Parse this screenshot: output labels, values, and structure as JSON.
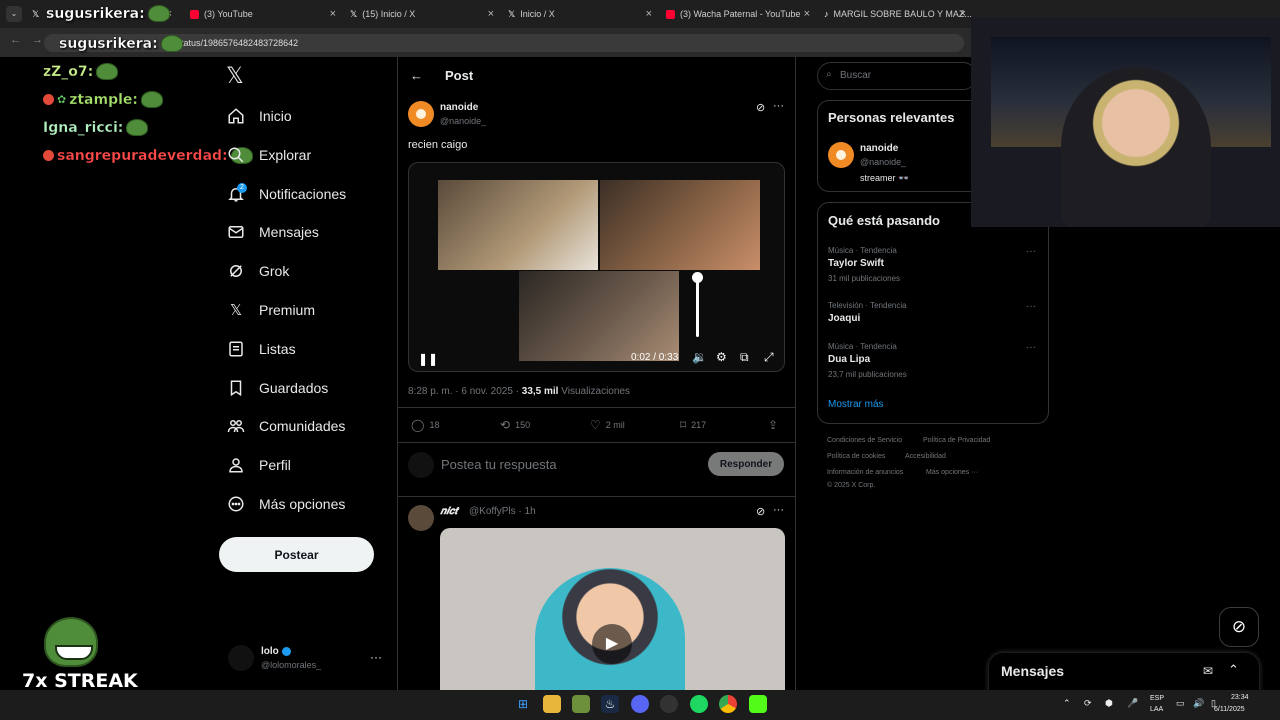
{
  "browser": {
    "tabs": [
      {
        "label": "",
        "icon": "x-icon",
        "color": "#ffffff"
      },
      {
        "label": "(3) YouTube",
        "icon": "youtube-icon",
        "color": "#ff0033"
      },
      {
        "label": "(15) Inicio / X",
        "icon": "x-icon",
        "color": "#ffffff"
      },
      {
        "label": "Inicio / X",
        "icon": "x-icon",
        "color": "#ffffff"
      },
      {
        "label": "(3) Wacha Paternal - YouTube",
        "icon": "youtube-icon",
        "color": "#ff0033"
      },
      {
        "label": "MARGIL SOBRE BAULO Y MAZ...",
        "icon": "tiktok-icon",
        "color": "#ffffff"
      }
    ],
    "url": "/status/1986576482483728642"
  },
  "chat": {
    "messages": [
      {
        "user": "sugusrikera:",
        "color": "#ffffff"
      },
      {
        "user": "sugusrikera:",
        "color": "#ffffff"
      },
      {
        "user": "zZ_o7:",
        "color": "#c9f08a"
      },
      {
        "user": "ztample:",
        "color": "#a6e06a"
      },
      {
        "user": "Igna_ricci:",
        "color": "#b3f0c0"
      },
      {
        "user": "sangrepuradeverdad:",
        "color": "#ff4a4a"
      }
    ],
    "streak": "7x STREAK"
  },
  "sidebar": {
    "items": [
      {
        "label": "Inicio",
        "icon": "home-icon"
      },
      {
        "label": "Explorar",
        "icon": "search-icon"
      },
      {
        "label": "Notificaciones",
        "icon": "bell-icon"
      },
      {
        "label": "Mensajes",
        "icon": "mail-icon"
      },
      {
        "label": "Grok",
        "icon": "grok-icon"
      },
      {
        "label": "Premium",
        "icon": "x-icon"
      },
      {
        "label": "Listas",
        "icon": "list-icon"
      },
      {
        "label": "Guardados",
        "icon": "bookmark-icon"
      },
      {
        "label": "Comunidades",
        "icon": "communities-icon"
      },
      {
        "label": "Perfil",
        "icon": "person-icon"
      },
      {
        "label": "Más opciones",
        "icon": "more-circle-icon"
      }
    ],
    "notif_count": "2",
    "post_button": "Postear",
    "account": {
      "name": "lolo",
      "handle": "@lolomorales_"
    }
  },
  "post": {
    "header": "Post",
    "author_name": "nanoide",
    "author_handle": "@nanoide_",
    "text": "recien caigo",
    "video_time": "0:02 / 0:33",
    "volume_level": 1.0,
    "timestamp": "8:28 p. m. · 6 nov. 2025 · ",
    "views_count": "33,5 mil",
    "views_label": " Visualizaciones",
    "actions": {
      "replies": "18",
      "reposts": "150",
      "likes": "2 mil",
      "bookmarks": "217"
    },
    "reply_placeholder": "Postea tu respuesta",
    "reply_button": "Responder"
  },
  "reply_post": {
    "name": "𝒏𝒊𝒄𝒕",
    "handle": "@KoffyPls · 1h"
  },
  "right": {
    "search_placeholder": "Buscar",
    "relevant_title": "Personas relevantes",
    "relevant_person": {
      "name": "nanoide",
      "handle": "@nanoide_",
      "bio": "streamer 👓"
    },
    "trending_title": "Qué está pasando",
    "trends": [
      {
        "category": "Música · Tendencia",
        "name": "Taylor Swift",
        "count": "31 mil publicaciones"
      },
      {
        "category": "Televisión · Tendencia",
        "name": "Joaqui",
        "count": ""
      },
      {
        "category": "Música · Tendencia",
        "name": "Dua Lipa",
        "count": "23,7 mil publicaciones"
      }
    ],
    "show_more": "Mostrar más",
    "footer": [
      "Condiciones de Servicio",
      "Política de Privacidad",
      "Política de cookies",
      "Accesibilidad",
      "Información de anuncios",
      "Más opciones ···",
      "© 2025 X Corp."
    ]
  },
  "messages_bar": {
    "title": "Mensajes"
  },
  "taskbar": {
    "lang_top": "ESP",
    "lang_bottom": "LAA",
    "time": "23:34",
    "date": "6/11/2025"
  },
  "colors": {
    "accent": "#1d9bf0",
    "background": "#000000",
    "border": "#2f3336",
    "muted": "#71767b"
  }
}
